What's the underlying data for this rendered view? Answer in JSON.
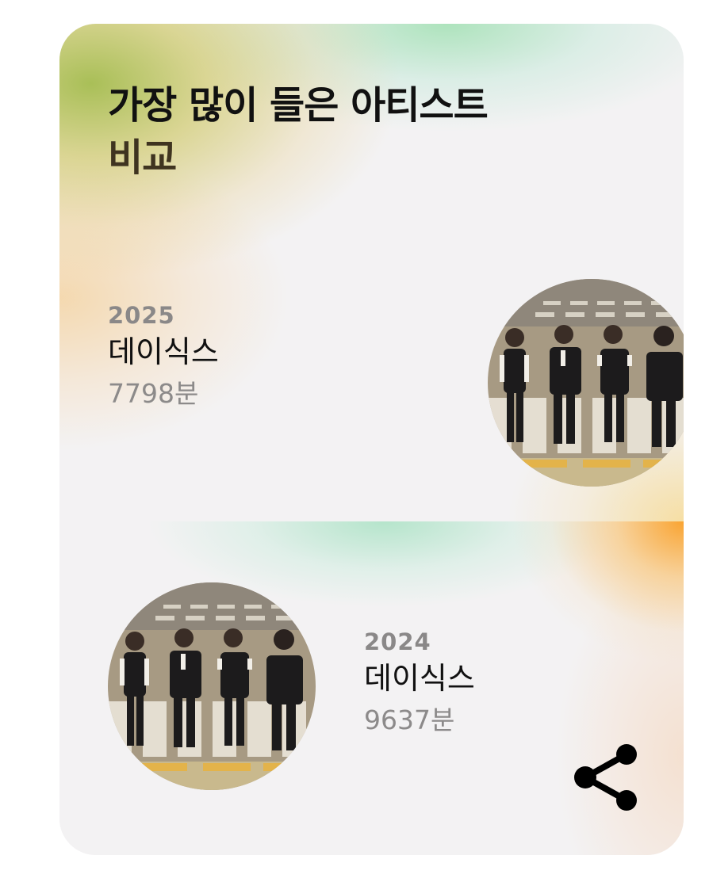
{
  "card": {
    "title_line1": "가장 많이 들은 아티스트",
    "title_line2": "비교"
  },
  "entries": [
    {
      "year": "2025",
      "artist": "데이식스",
      "minutes": "7798분",
      "image_icon": "artist-photo"
    },
    {
      "year": "2024",
      "artist": "데이식스",
      "minutes": "9637분",
      "image_icon": "artist-photo"
    }
  ],
  "actions": {
    "share_icon": "share-icon"
  },
  "colors": {
    "title_primary": "#111111",
    "title_secondary": "#3f3420",
    "muted_text": "#8a8888",
    "accent_green": "#9cb63c",
    "accent_orange": "#faa028",
    "accent_mint": "#aae2c4",
    "card_background": "#f3f2f3"
  }
}
